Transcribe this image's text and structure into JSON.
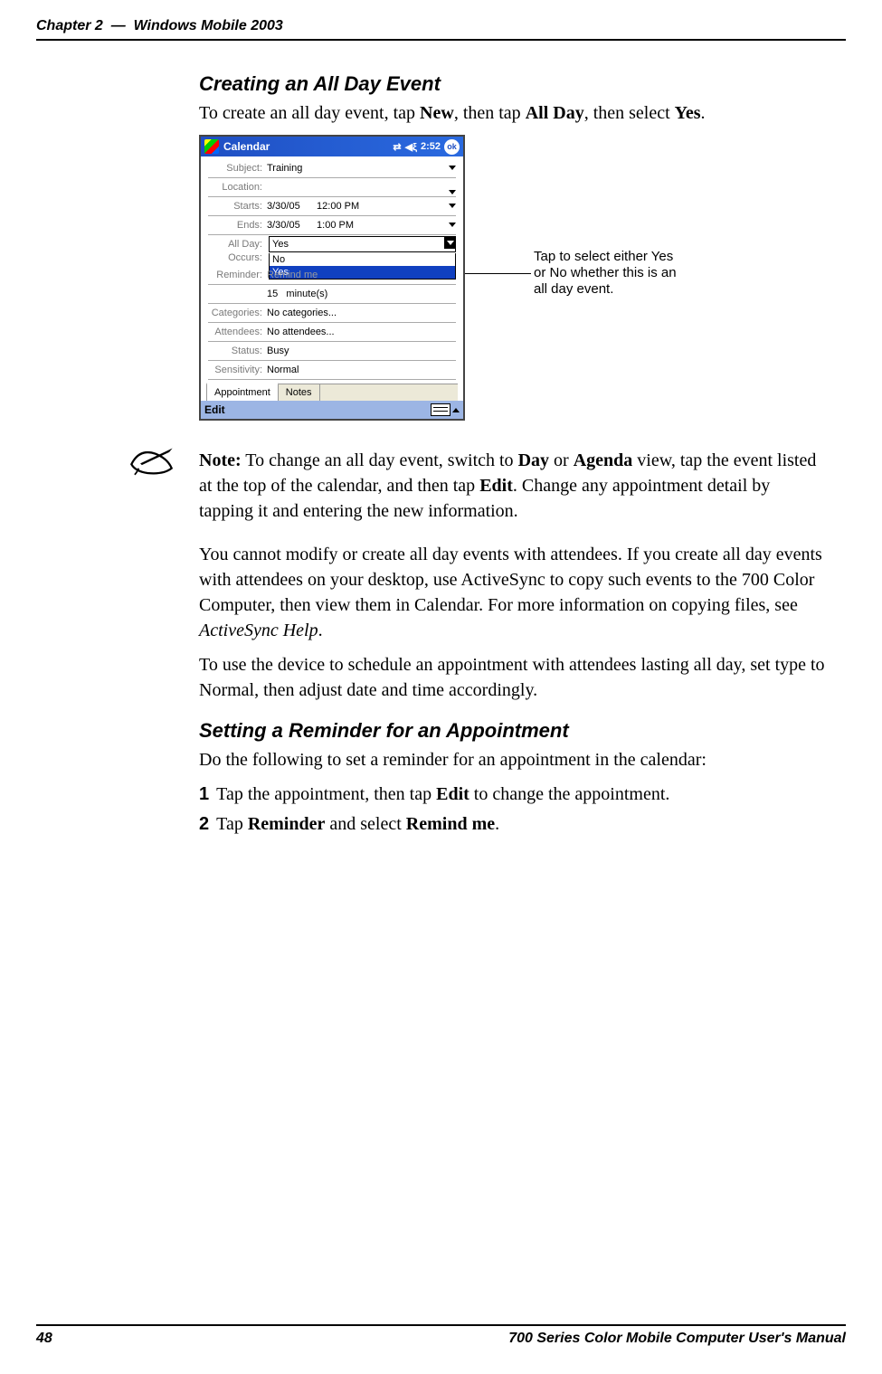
{
  "header": {
    "chapter": "Chapter 2",
    "dash": "—",
    "title": "Windows Mobile 2003"
  },
  "footer": {
    "page": "48",
    "manual": "700 Series Color Mobile Computer User's Manual"
  },
  "section1": {
    "title": "Creating an All Day Event",
    "intro_pre": "To create an all day event, tap ",
    "intro_b1": "New",
    "intro_mid1": ", then tap ",
    "intro_b2": "All Day",
    "intro_mid2": ", then select ",
    "intro_b3": "Yes",
    "intro_end": "."
  },
  "screenshot": {
    "titlebar_app": "Calendar",
    "time": "2:52",
    "ok": "ok",
    "labels": {
      "subject": "Subject:",
      "location": "Location:",
      "starts": "Starts:",
      "ends": "Ends:",
      "allday": "All Day:",
      "occurs": "Occurs:",
      "reminder": "Reminder:",
      "reminder_qty": "15",
      "reminder_unit": "minute(s)",
      "categories": "Categories:",
      "attendees": "Attendees:",
      "status": "Status:",
      "sensitivity": "Sensitivity:"
    },
    "values": {
      "subject": "Training",
      "starts_date": "3/30/05",
      "starts_time": "12:00 PM",
      "ends_date": "3/30/05",
      "ends_time": "1:00 PM",
      "allday_selected": "Yes",
      "allday_opt_no": "No",
      "allday_opt_yes": "Yes",
      "reminder_covered": "Remind me",
      "categories": "No categories...",
      "attendees": "No attendees...",
      "status": "Busy",
      "sensitivity": "Normal"
    },
    "tabs": {
      "appointment": "Appointment",
      "notes": "Notes"
    },
    "bottombar": {
      "edit": "Edit"
    }
  },
  "callout": {
    "text": "Tap to select either Yes or No whether this is an all day event."
  },
  "note": {
    "prefix": "Note:",
    "text1": " To change an all day event, switch to ",
    "b1": "Day",
    "text2": " or ",
    "b2": "Agenda",
    "text3": " view, tap the event listed at the top of the calendar, and then tap ",
    "b3": "Edit",
    "text4": ". Change any appointment detail by tapping it and entering the new information."
  },
  "para2": {
    "p1": "You cannot modify or create all day events with attendees. If you create all day events with attendees on your desktop, use ActiveSync to copy such events to the 700 Color Computer, then view them in Calendar. For more information on copying files, see ",
    "i1": "ActiveSync Help",
    "p1b": "."
  },
  "para3": "To use the device to schedule an appointment with attendees lasting all day, set type to Normal, then adjust date and time accordingly.",
  "section2": {
    "title": "Setting a Reminder for an Appointment",
    "intro": "Do the following to set a reminder for an appointment in the calendar:",
    "step1_num": "1",
    "step1_a": "Tap the appointment, then tap ",
    "step1_b": "Edit",
    "step1_c": " to change the appointment.",
    "step2_num": "2",
    "step2_a": "Tap ",
    "step2_b": "Reminder",
    "step2_c": " and select ",
    "step2_d": "Remind me",
    "step2_e": "."
  }
}
